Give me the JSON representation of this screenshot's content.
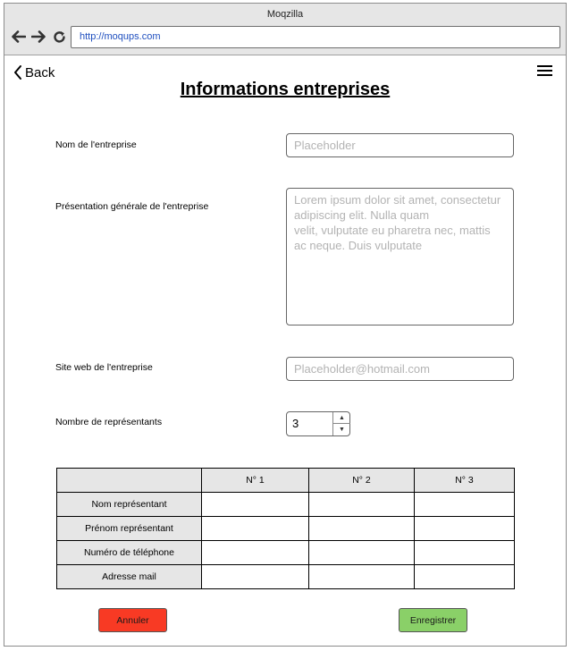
{
  "browser": {
    "title": "Moqzilla",
    "url": "http://moqups.com"
  },
  "header": {
    "back_label": "Back",
    "page_title": "Informations entreprises"
  },
  "form": {
    "company_name": {
      "label": "Nom de l'entreprise",
      "placeholder": "Placeholder"
    },
    "presentation": {
      "label": "Présentation générale de l'entreprise",
      "placeholder": "Lorem ipsum dolor sit amet, consectetur\nadipiscing elit. Nulla quam\nvelit, vulputate eu pharetra nec, mattis\nac neque. Duis vulputate"
    },
    "website": {
      "label": "Site web de l'entreprise",
      "placeholder": "Placeholder@hotmail.com"
    },
    "rep_count": {
      "label": "Nombre de représentants",
      "value": "3"
    }
  },
  "table": {
    "columns": [
      "",
      "N° 1",
      "N° 2",
      "N° 3"
    ],
    "rows": [
      "Nom représentant",
      "Prénom représentant",
      "Numéro de téléphone",
      "Adresse mail"
    ]
  },
  "actions": {
    "cancel_label": "Annuler",
    "save_label": "Enregistrer"
  },
  "colors": {
    "cancel": "#f83a24",
    "save": "#8ad068"
  }
}
